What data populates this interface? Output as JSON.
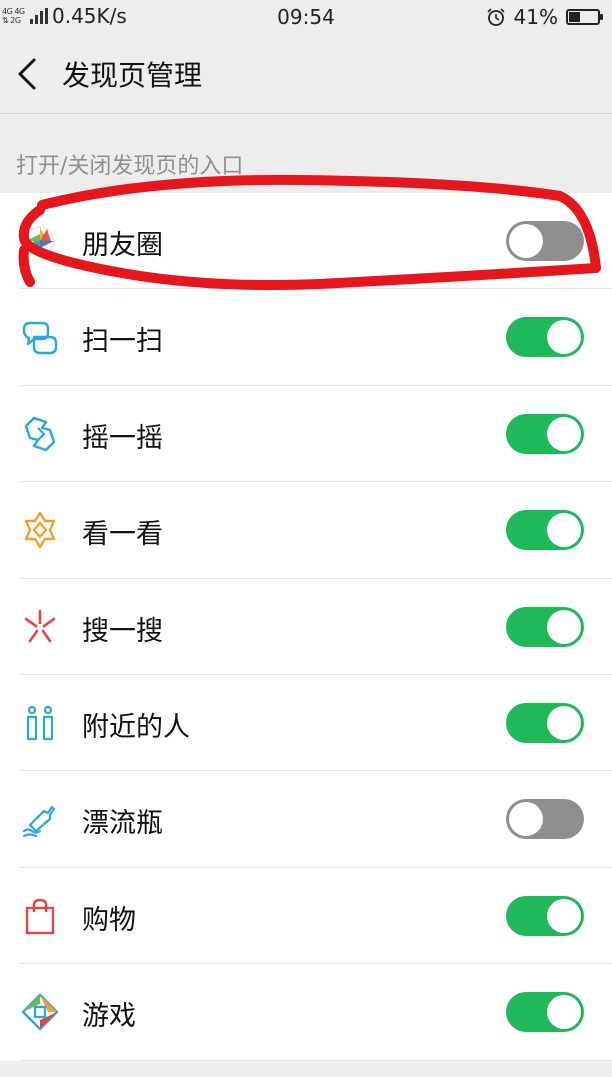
{
  "status_bar": {
    "network_type": "4G 4G\n⇅ 2G",
    "net_speed": "0.45K/s",
    "time": "09:54",
    "battery_percent": "41%",
    "battery_level": 0.41
  },
  "nav": {
    "title": "发现页管理"
  },
  "section": {
    "header": "打开/关闭发现页的入口"
  },
  "items": [
    {
      "label": "朋友圈",
      "icon": "moments-icon",
      "enabled": false
    },
    {
      "label": "扫一扫",
      "icon": "scan-icon",
      "enabled": true
    },
    {
      "label": "摇一摇",
      "icon": "shake-icon",
      "enabled": true
    },
    {
      "label": "看一看",
      "icon": "top-stories-icon",
      "enabled": true
    },
    {
      "label": "搜一搜",
      "icon": "search-icon",
      "enabled": true
    },
    {
      "label": "附近的人",
      "icon": "people-nearby-icon",
      "enabled": true
    },
    {
      "label": "漂流瓶",
      "icon": "drift-bottle-icon",
      "enabled": false
    },
    {
      "label": "购物",
      "icon": "shopping-bag-icon",
      "enabled": true
    },
    {
      "label": "游戏",
      "icon": "games-icon",
      "enabled": true
    }
  ],
  "colors": {
    "toggle_on": "#1fb85b",
    "toggle_off": "#8e8e8e",
    "annotation": "#e5161c"
  }
}
